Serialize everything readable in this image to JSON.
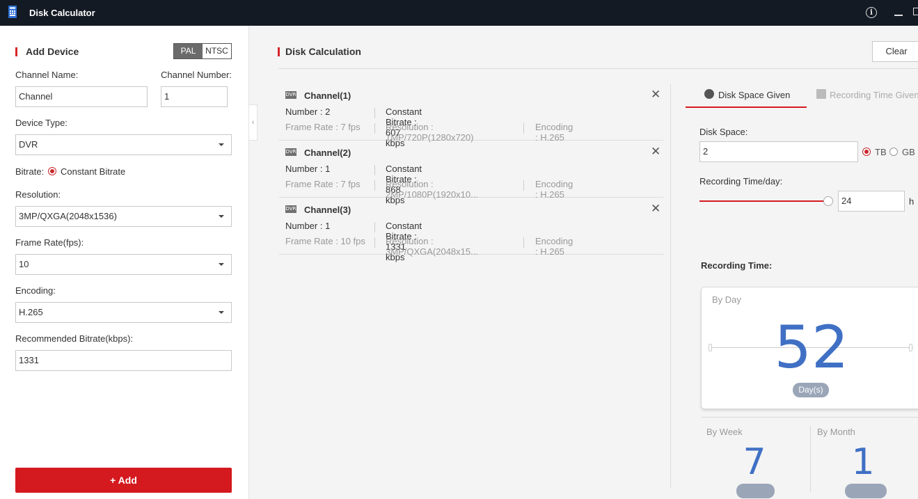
{
  "window": {
    "title": "Disk Calculator",
    "info_icon": "info-icon",
    "min_icon": "minimize-icon",
    "max_icon": "maximize-icon"
  },
  "add_device": {
    "title": "Add Device",
    "standard": {
      "options": [
        "PAL",
        "NTSC"
      ],
      "selected": "PAL"
    },
    "channel_name": {
      "label": "Channel Name:",
      "value": "Channel"
    },
    "channel_number": {
      "label": "Channel Number:",
      "value": "1"
    },
    "device_type": {
      "label": "Device Type:",
      "value": "DVR"
    },
    "bitrate": {
      "label": "Bitrate:",
      "option": "Constant Bitrate"
    },
    "resolution": {
      "label": "Resolution:",
      "value": "3MP/QXGA(2048x1536)"
    },
    "frame_rate": {
      "label": "Frame Rate(fps):",
      "value": "10"
    },
    "encoding": {
      "label": "Encoding:",
      "value": "H.265"
    },
    "recommended_bitrate": {
      "label": "Recommended Bitrate(kbps):",
      "value": "1331"
    },
    "add_button": "+ Add"
  },
  "disk_calc": {
    "title": "Disk Calculation",
    "clear_label": "Clear",
    "channels": [
      {
        "badge": "DVR",
        "name": "Channel(1)",
        "number": "Number : 2",
        "bitrate": "Constant Bitrate : 607 kbps",
        "frame_rate": "Frame Rate : 7 fps",
        "resolution": "Resolution : 1MP/720P(1280x720)",
        "encoding": "Encoding : H.265"
      },
      {
        "badge": "DVR",
        "name": "Channel(2)",
        "number": "Number : 1",
        "bitrate": "Constant Bitrate : 868 kbps",
        "frame_rate": "Frame Rate : 7 fps",
        "resolution": "Resolution : 2MP/1080P(1920x10...",
        "encoding": "Encoding : H.265"
      },
      {
        "badge": "DVR",
        "name": "Channel(3)",
        "number": "Number : 1",
        "bitrate": "Constant Bitrate : 1331 kbps",
        "frame_rate": "Frame Rate : 10 fps",
        "resolution": "Resolution : 3MP/QXGA(2048x15...",
        "encoding": "Encoding : H.265"
      }
    ]
  },
  "right": {
    "tabs": {
      "active": "Disk Space Given",
      "inactive": "Recording Time Given"
    },
    "disk_space": {
      "label": "Disk Space:",
      "value": "2",
      "unit_tb": "TB",
      "unit_gb": "GB",
      "selected_unit": "TB"
    },
    "recording_per_day": {
      "label": "Recording Time/day:",
      "value": "24",
      "unit": "h",
      "level": 1.0
    },
    "recording_time": {
      "label": "Recording Time:",
      "by_day": {
        "label": "By Day",
        "value": "52",
        "unit": "Day(s)"
      },
      "by_week": {
        "label": "By Week",
        "value": "7"
      },
      "by_month": {
        "label": "By Month",
        "value": "1"
      }
    }
  }
}
